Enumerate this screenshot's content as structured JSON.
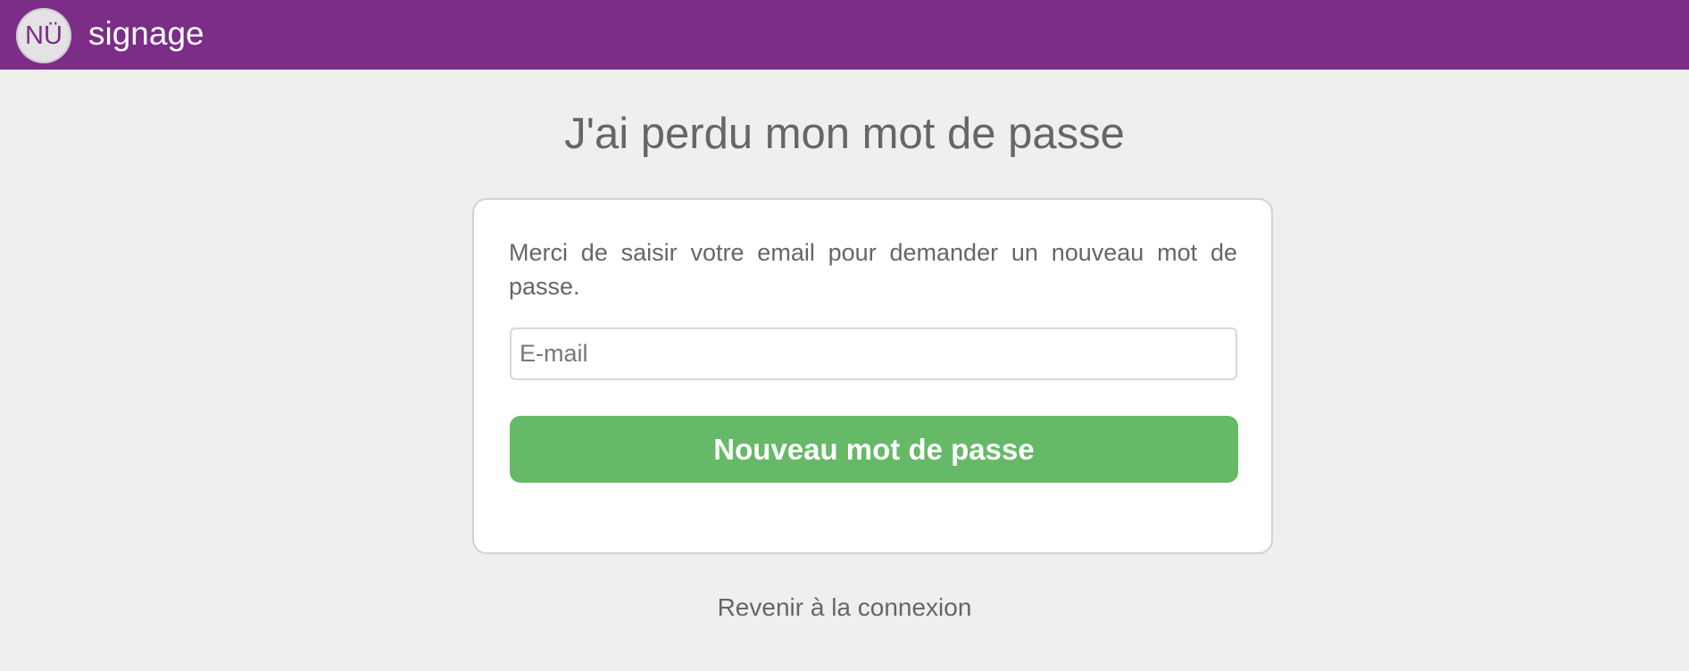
{
  "header": {
    "logo_text": "NÜ",
    "brand_name": "signage",
    "background_color": "#7b2d88"
  },
  "page": {
    "title": "J'ai perdu mon mot de passe",
    "background_color": "#efefef"
  },
  "form": {
    "instruction": "Merci de saisir votre email pour demander un nouveau mot de passe.",
    "email_value": "",
    "email_placeholder": "E-mail",
    "submit_label": "Nouveau mot de passe",
    "submit_color": "#66b966"
  },
  "footer": {
    "back_link_label": "Revenir à la connexion"
  }
}
